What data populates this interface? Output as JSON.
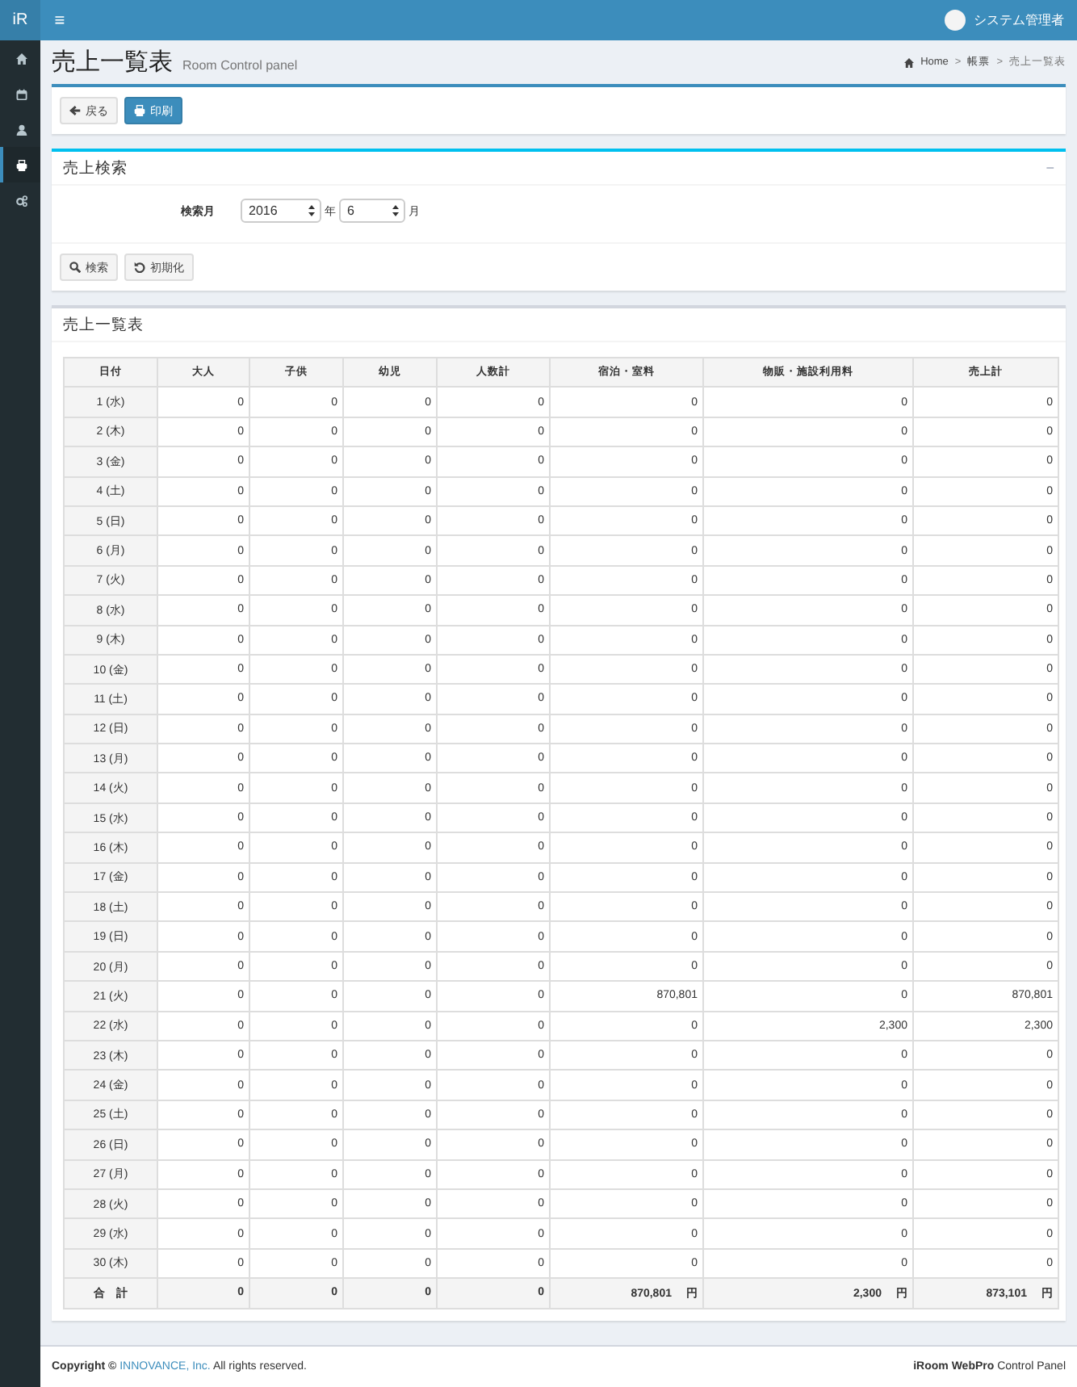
{
  "header": {
    "logo": "iR",
    "menu_icon": "≡",
    "user": "システム管理者"
  },
  "sidebar": {
    "items": [
      {
        "selected": false
      },
      {
        "selected": false
      },
      {
        "selected": false
      },
      {
        "selected": true
      },
      {
        "selected": false
      }
    ]
  },
  "page": {
    "title": "売上一覧表",
    "subtitle": "Room Control panel"
  },
  "breadcrumb": {
    "separator": ">",
    "items": [
      {
        "label": "Home",
        "kind": "home"
      },
      {
        "label": "帳票",
        "kind": "link"
      },
      {
        "label": "売上一覧表",
        "kind": "current"
      }
    ]
  },
  "actions": [
    {
      "label": "戻る",
      "kind": "default"
    },
    {
      "label": "印刷",
      "kind": "primary"
    }
  ],
  "search": {
    "title": "売上検索",
    "collapse": "−",
    "field_label": "検索月",
    "year": {
      "value": "2016",
      "unit": "年"
    },
    "month": {
      "value": "6",
      "unit": "月"
    },
    "buttons": [
      {
        "label": "検索"
      },
      {
        "label": "初期化"
      }
    ]
  },
  "table": {
    "title": "売上一覧表",
    "columns": [
      "日付",
      "大人",
      "子供",
      "幼児",
      "人数計",
      "宿泊・室料",
      "物販・施設利用料",
      "売上計"
    ],
    "rows": [
      [
        "1 (水)",
        "0",
        "0",
        "0",
        "0",
        "0",
        "0",
        "0"
      ],
      [
        "2 (木)",
        "0",
        "0",
        "0",
        "0",
        "0",
        "0",
        "0"
      ],
      [
        "3 (金)",
        "0",
        "0",
        "0",
        "0",
        "0",
        "0",
        "0"
      ],
      [
        "4 (土)",
        "0",
        "0",
        "0",
        "0",
        "0",
        "0",
        "0"
      ],
      [
        "5 (日)",
        "0",
        "0",
        "0",
        "0",
        "0",
        "0",
        "0"
      ],
      [
        "6 (月)",
        "0",
        "0",
        "0",
        "0",
        "0",
        "0",
        "0"
      ],
      [
        "7 (火)",
        "0",
        "0",
        "0",
        "0",
        "0",
        "0",
        "0"
      ],
      [
        "8 (水)",
        "0",
        "0",
        "0",
        "0",
        "0",
        "0",
        "0"
      ],
      [
        "9 (木)",
        "0",
        "0",
        "0",
        "0",
        "0",
        "0",
        "0"
      ],
      [
        "10 (金)",
        "0",
        "0",
        "0",
        "0",
        "0",
        "0",
        "0"
      ],
      [
        "11 (土)",
        "0",
        "0",
        "0",
        "0",
        "0",
        "0",
        "0"
      ],
      [
        "12 (日)",
        "0",
        "0",
        "0",
        "0",
        "0",
        "0",
        "0"
      ],
      [
        "13 (月)",
        "0",
        "0",
        "0",
        "0",
        "0",
        "0",
        "0"
      ],
      [
        "14 (火)",
        "0",
        "0",
        "0",
        "0",
        "0",
        "0",
        "0"
      ],
      [
        "15 (水)",
        "0",
        "0",
        "0",
        "0",
        "0",
        "0",
        "0"
      ],
      [
        "16 (木)",
        "0",
        "0",
        "0",
        "0",
        "0",
        "0",
        "0"
      ],
      [
        "17 (金)",
        "0",
        "0",
        "0",
        "0",
        "0",
        "0",
        "0"
      ],
      [
        "18 (土)",
        "0",
        "0",
        "0",
        "0",
        "0",
        "0",
        "0"
      ],
      [
        "19 (日)",
        "0",
        "0",
        "0",
        "0",
        "0",
        "0",
        "0"
      ],
      [
        "20 (月)",
        "0",
        "0",
        "0",
        "0",
        "0",
        "0",
        "0"
      ],
      [
        "21 (火)",
        "0",
        "0",
        "0",
        "0",
        "870,801",
        "0",
        "870,801"
      ],
      [
        "22 (水)",
        "0",
        "0",
        "0",
        "0",
        "0",
        "2,300",
        "2,300"
      ],
      [
        "23 (木)",
        "0",
        "0",
        "0",
        "0",
        "0",
        "0",
        "0"
      ],
      [
        "24 (金)",
        "0",
        "0",
        "0",
        "0",
        "0",
        "0",
        "0"
      ],
      [
        "25 (土)",
        "0",
        "0",
        "0",
        "0",
        "0",
        "0",
        "0"
      ],
      [
        "26 (日)",
        "0",
        "0",
        "0",
        "0",
        "0",
        "0",
        "0"
      ],
      [
        "27 (月)",
        "0",
        "0",
        "0",
        "0",
        "0",
        "0",
        "0"
      ],
      [
        "28 (火)",
        "0",
        "0",
        "0",
        "0",
        "0",
        "0",
        "0"
      ],
      [
        "29 (水)",
        "0",
        "0",
        "0",
        "0",
        "0",
        "0",
        "0"
      ],
      [
        "30 (木)",
        "0",
        "0",
        "0",
        "0",
        "0",
        "0",
        "0"
      ]
    ],
    "total": [
      {
        "value": "合　計"
      },
      {
        "value": "0"
      },
      {
        "value": "0"
      },
      {
        "value": "0"
      },
      {
        "value": "0"
      },
      {
        "value": "870,801",
        "unit": "円"
      },
      {
        "value": "2,300",
        "unit": "円"
      },
      {
        "value": "873,101",
        "unit": "円"
      }
    ]
  },
  "footer": {
    "prefix": "Copyright ©",
    "company": "INNOVANCE, Inc.",
    "suffix": "All rights reserved.",
    "product": "**iRoom WebPro** Control Panel"
  }
}
